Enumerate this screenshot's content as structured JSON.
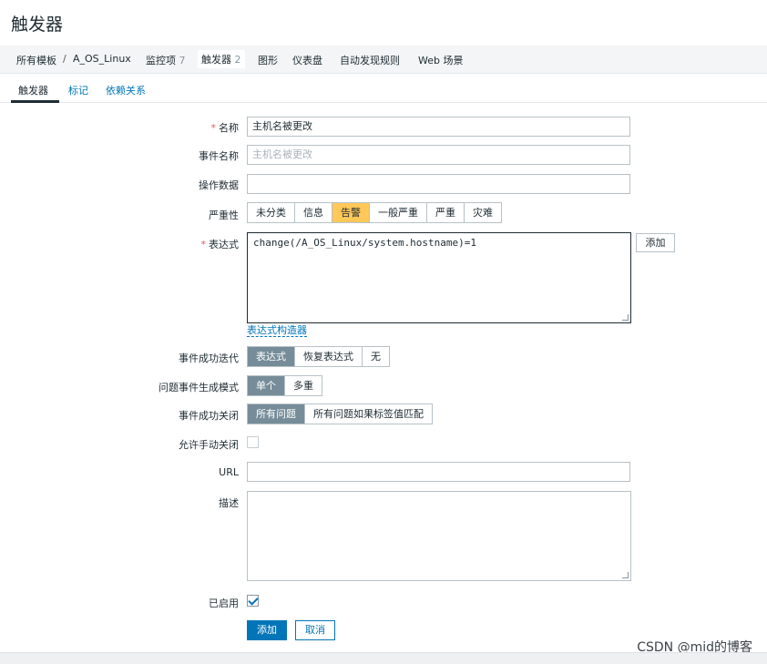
{
  "page": {
    "title": "触发器"
  },
  "breadcrumb": {
    "items": [
      {
        "label": "所有模板"
      },
      {
        "label": "/"
      },
      {
        "label": "A_OS_Linux"
      },
      {
        "label": "监控项",
        "count": "7"
      },
      {
        "label": "触发器",
        "count": "2"
      },
      {
        "label": "图形"
      },
      {
        "label": "仪表盘"
      },
      {
        "label": "自动发现规则"
      },
      {
        "label": "Web 场景"
      }
    ]
  },
  "tabs": [
    {
      "label": "触发器"
    },
    {
      "label": "标记"
    },
    {
      "label": "依赖关系"
    }
  ],
  "form": {
    "name": {
      "label": "名称",
      "required": "*",
      "value": "主机名被更改"
    },
    "event_name": {
      "label": "事件名称",
      "placeholder": "主机名被更改"
    },
    "opdata": {
      "label": "操作数据",
      "value": ""
    },
    "severity": {
      "label": "严重性",
      "options": [
        "未分类",
        "信息",
        "告警",
        "一般严重",
        "严重",
        "灾难"
      ],
      "selected": "告警",
      "selected_color": "#ffc859"
    },
    "expression": {
      "label": "表达式",
      "required": "*",
      "value": "change(/A_OS_Linux/system.hostname)=1",
      "add_button": "添加",
      "constructor_link": "表达式构造器"
    },
    "ok_event_generation": {
      "label": "事件成功迭代",
      "options": [
        "表达式",
        "恢复表达式",
        "无"
      ],
      "selected": "表达式"
    },
    "problem_mode": {
      "label": "问题事件生成模式",
      "options": [
        "单个",
        "多重"
      ],
      "selected": "单个"
    },
    "ok_close": {
      "label": "事件成功关闭",
      "options": [
        "所有问题",
        "所有问题如果标签值匹配"
      ],
      "selected": "所有问题"
    },
    "manual_close": {
      "label": "允许手动关闭",
      "checked": false
    },
    "url": {
      "label": "URL",
      "value": ""
    },
    "description": {
      "label": "描述",
      "value": ""
    },
    "enabled": {
      "label": "已启用",
      "checked": true
    },
    "buttons": {
      "add": "添加",
      "cancel": "取消"
    }
  },
  "watermark": {
    "text": "CSDN @mid的博客"
  },
  "colors": {
    "accent": "#0275b8",
    "selected_segment": "#768d99"
  }
}
